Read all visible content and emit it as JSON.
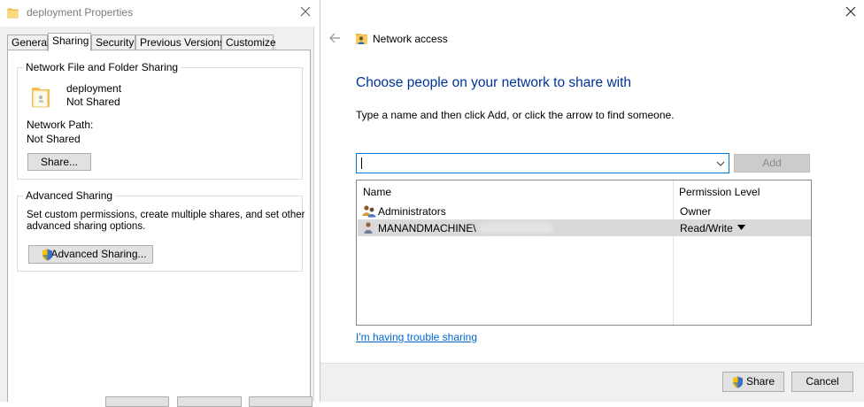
{
  "properties": {
    "title": "deployment Properties",
    "tabs": [
      {
        "label": "General"
      },
      {
        "label": "Sharing"
      },
      {
        "label": "Security"
      },
      {
        "label": "Previous Versions"
      },
      {
        "label": "Customize"
      }
    ],
    "network_sharing": {
      "legend": "Network File and Folder Sharing",
      "folder_name": "deployment",
      "share_status": "Not Shared",
      "network_path_label": "Network Path:",
      "network_path_value": "Not Shared",
      "share_button": "Share..."
    },
    "advanced_sharing": {
      "legend": "Advanced Sharing",
      "description_line1": "Set custom permissions, create multiple shares, and set other",
      "description_line2": "advanced sharing options.",
      "button": "Advanced Sharing..."
    }
  },
  "wizard": {
    "title": "Network access",
    "heading": "Choose people on your network to share with",
    "instructions": "Type a name and then click Add, or click the arrow to find someone.",
    "input_value": "",
    "add_button": "Add",
    "table": {
      "headers": {
        "name": "Name",
        "permission": "Permission Level"
      },
      "rows": [
        {
          "name": "Administrators",
          "permission": "Owner",
          "icon": "group-users-icon"
        },
        {
          "name": "MANANDMACHINE\\",
          "permission": "Read/Write",
          "icon": "user-icon",
          "selected": true
        }
      ]
    },
    "trouble_link": "I'm having trouble sharing",
    "share_button": "Share",
    "cancel_button": "Cancel"
  },
  "colors": {
    "heading": "#003399",
    "link": "#0066cc",
    "focus_border": "#0078d7",
    "dialog_bg": "#f0f0f0"
  }
}
